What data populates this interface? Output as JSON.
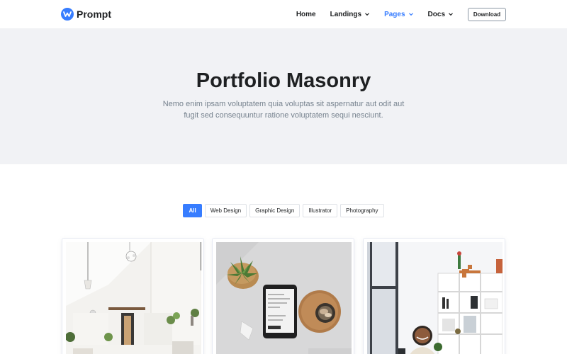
{
  "brand": {
    "name": "Prompt",
    "logo_icon": "prompt-logo-icon",
    "logo_color": "#377dff"
  },
  "nav": {
    "items": [
      {
        "label": "Home",
        "dropdown": false,
        "active": false
      },
      {
        "label": "Landings",
        "dropdown": true,
        "active": false
      },
      {
        "label": "Pages",
        "dropdown": true,
        "active": true
      },
      {
        "label": "Docs",
        "dropdown": true,
        "active": false
      }
    ],
    "download_label": "Download"
  },
  "hero": {
    "title": "Portfolio Masonry",
    "subtitle_line1": "Nemo enim ipsam voluptatem quia voluptas sit aspernatur aut odit aut",
    "subtitle_line2": "fugit sed consequuntur ratione voluptatem sequi nesciunt."
  },
  "filters": {
    "items": [
      {
        "label": "All",
        "active": true
      },
      {
        "label": "Web Design",
        "active": false
      },
      {
        "label": "Graphic Design",
        "active": false
      },
      {
        "label": "Illustrator",
        "active": false
      },
      {
        "label": "Photography",
        "active": false
      }
    ]
  },
  "portfolio": {
    "items": [
      {
        "image": "bright-interior-room-photo"
      },
      {
        "image": "smartphone-succulent-desk-photo"
      },
      {
        "image": "woman-at-bookshelf-office-photo"
      }
    ]
  },
  "colors": {
    "accent": "#377dff",
    "hero_bg": "#f1f2f5",
    "text_dark": "#1e2022",
    "text_muted": "#77838f"
  }
}
